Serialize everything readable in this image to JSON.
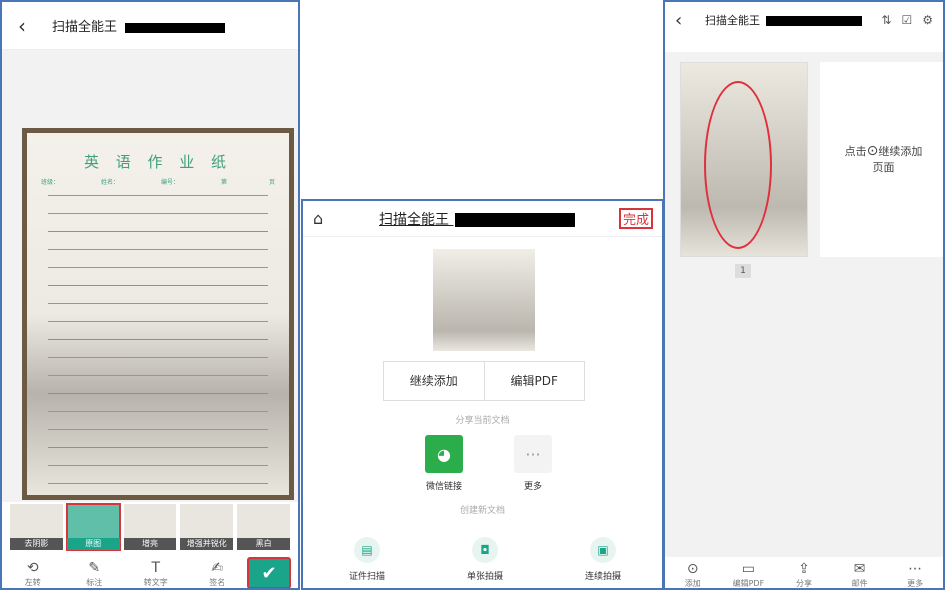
{
  "colors": {
    "accent": "#1aa58a",
    "highlight_red": "#d8343c",
    "frame_blue": "#4a76b8"
  },
  "panel1": {
    "back_icon": "chevron-left-icon",
    "title": "扫描全能王",
    "paper_title": "英 语 作 业 纸",
    "paper_fields": [
      "班级：",
      "姓名：",
      "编号：",
      "第",
      "页"
    ],
    "filters": [
      "去阴影",
      "原图",
      "增亮",
      "增强并锐化",
      "黑白"
    ],
    "selected_filter": "原图",
    "tools": [
      {
        "icon": "rotate-icon",
        "label": "左转"
      },
      {
        "icon": "pen-icon",
        "label": "标注"
      },
      {
        "icon": "text-recognize-icon",
        "label": "转文字"
      },
      {
        "icon": "signature-icon",
        "label": "签名"
      }
    ],
    "confirm_icon": "check-icon"
  },
  "panel2": {
    "home_icon": "home-icon",
    "title": "扫描全能王",
    "done_label": "完成",
    "continue_label": "继续添加",
    "edit_pdf_label": "编辑PDF",
    "share_section": "分享当前文档",
    "share_items": [
      {
        "icon": "wechat-icon",
        "label": "微信链接"
      },
      {
        "icon": "more-icon",
        "label": "更多"
      }
    ],
    "create_section": "创建新文档",
    "create_items": [
      {
        "icon": "id-card-icon",
        "label": "证件扫描"
      },
      {
        "icon": "camera-icon",
        "label": "单张拍摄"
      },
      {
        "icon": "image-icon",
        "label": "连续拍摄"
      }
    ]
  },
  "panel3": {
    "back_icon": "chevron-left-icon",
    "title": "扫描全能王",
    "top_icons": [
      "sort-icon",
      "select-icon",
      "settings-icon"
    ],
    "page_number": "1",
    "add_page_text_before": "点击",
    "add_page_text_after": "继续添加",
    "add_page_text_line2": "页面",
    "bottom_items": [
      {
        "icon": "camera-add-icon",
        "label": "添加"
      },
      {
        "icon": "pdf-icon",
        "label": "编辑PDF"
      },
      {
        "icon": "share-icon",
        "label": "分享"
      },
      {
        "icon": "mail-icon",
        "label": "邮件"
      },
      {
        "icon": "more-icon",
        "label": "更多"
      }
    ]
  }
}
